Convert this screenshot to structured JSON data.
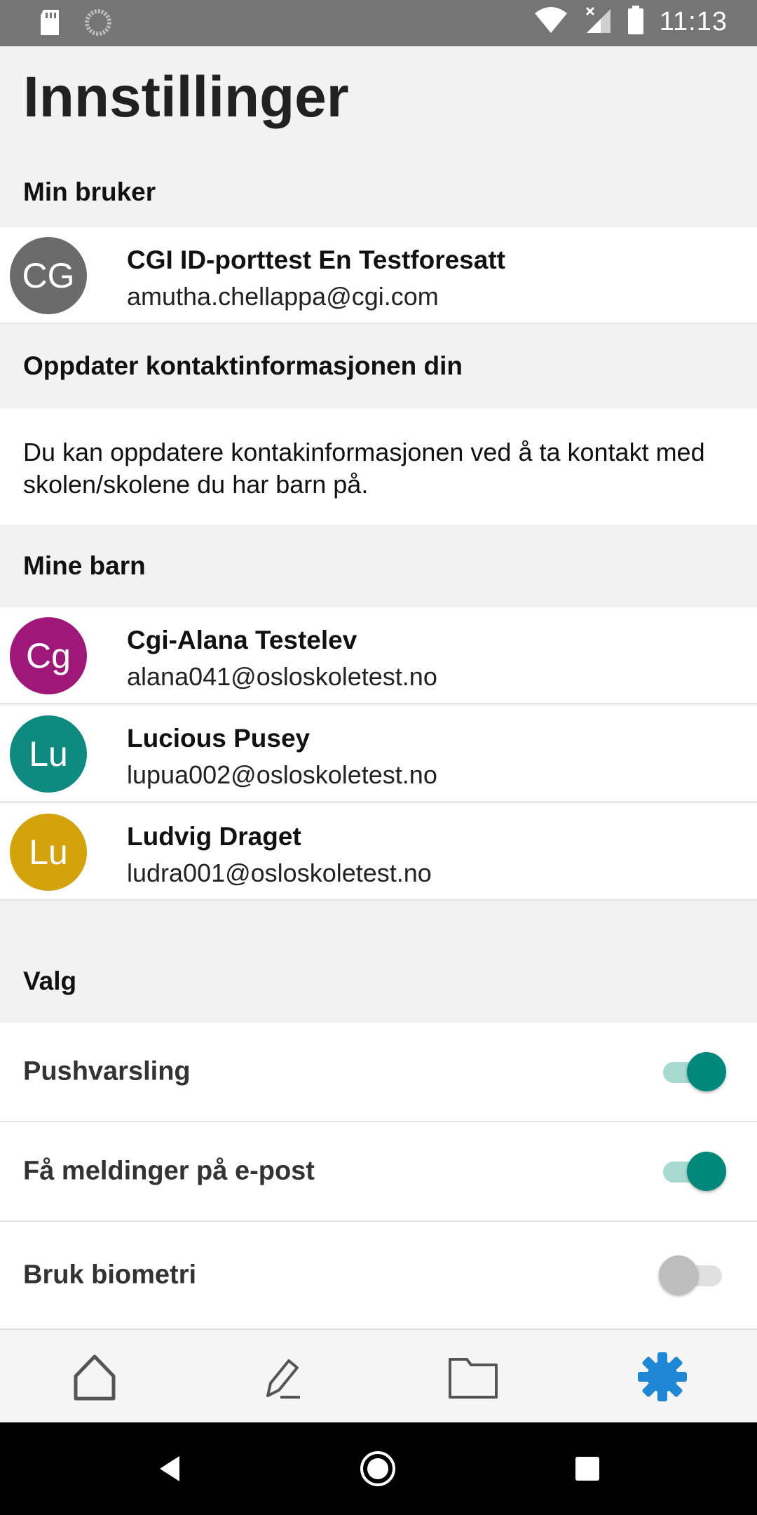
{
  "status_bar": {
    "time": "11:13",
    "icons": [
      "sd-card-icon",
      "sync-icon",
      "wifi-icon",
      "signal-icon",
      "battery-icon"
    ]
  },
  "page": {
    "title": "Innstillinger"
  },
  "my_user": {
    "header": "Min bruker",
    "avatar_initials": "CG",
    "avatar_color": "#6b6b6b",
    "name": "CGI ID-porttest En Testforesatt",
    "email": "amutha.chellappa@cgi.com"
  },
  "contact_info": {
    "header": "Oppdater kontaktinformasjonen din",
    "text": "Du kan oppdatere kontakinformasjonen ved å ta kontakt med skolen/skolene du har barn på."
  },
  "children": {
    "header": "Mine barn",
    "items": [
      {
        "initials": "Cg",
        "color": "#a0177a",
        "name": "Cgi-Alana Testelev",
        "email": "alana041@osloskoletest.no"
      },
      {
        "initials": "Lu",
        "color": "#0f8a80",
        "name": "Lucious Pusey",
        "email": "lupua002@osloskoletest.no"
      },
      {
        "initials": "Lu",
        "color": "#d4a20a",
        "name": "Ludvig Draget",
        "email": "ludra001@osloskoletest.no"
      }
    ]
  },
  "options": {
    "header": "Valg",
    "items": [
      {
        "label": "Pushvarsling",
        "enabled": true
      },
      {
        "label": "Få meldinger på e-post",
        "enabled": true
      },
      {
        "label": "Bruk biometri",
        "enabled": false
      }
    ]
  },
  "bottom_nav": {
    "items": [
      "home-icon",
      "edit-icon",
      "folder-icon",
      "settings-icon"
    ],
    "active_index": 3,
    "active_color": "#1e88d6",
    "inactive_color": "#555555"
  },
  "system_nav": [
    "back-icon",
    "home-circle-icon",
    "recents-icon"
  ]
}
